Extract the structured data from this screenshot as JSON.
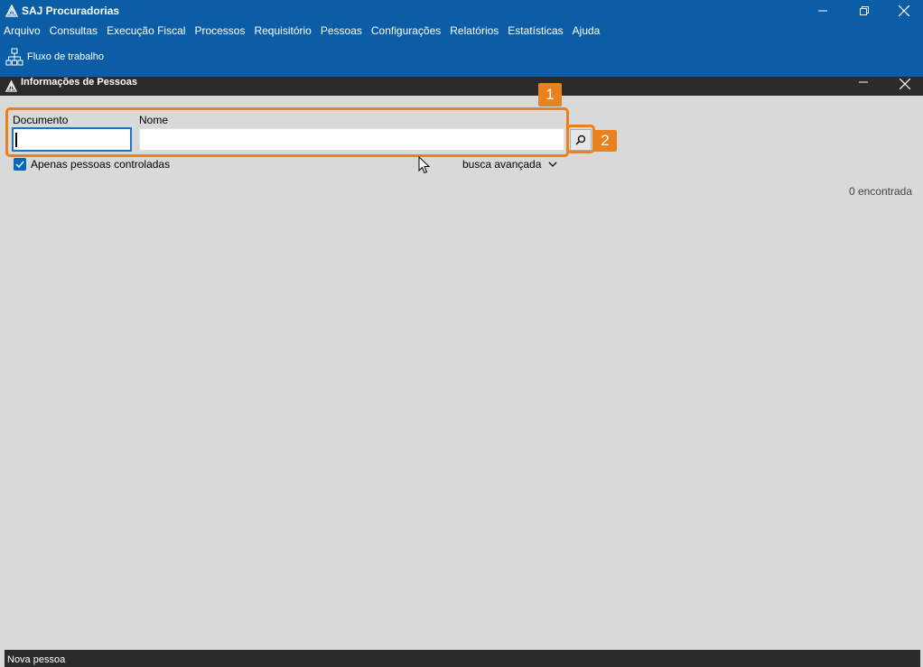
{
  "window": {
    "title": "SAJ Procuradorias",
    "minimize_icon": "minimize-icon",
    "restore_icon": "restore-icon",
    "close_icon": "close-icon"
  },
  "menubar": {
    "items": [
      "Arquivo",
      "Consultas",
      "Execução Fiscal",
      "Processos",
      "Requisitório",
      "Pessoas",
      "Configurações",
      "Relatórios",
      "Estatísticas",
      "Ajuda"
    ]
  },
  "toolbar": {
    "workflow_label": "Fluxo de trabalho",
    "workflow_icon": "workflow-icon"
  },
  "subwindow": {
    "title": "Informações de Pessoas"
  },
  "form": {
    "documento_label": "Documento",
    "documento_value": "",
    "nome_label": "Nome",
    "nome_value": "",
    "search_icon": "search-icon",
    "checkbox_label": "Apenas pessoas controladas",
    "checkbox_checked": true,
    "advanced_search_label": "busca avançada",
    "result_count": "0 encontrada"
  },
  "callouts": {
    "first": "1",
    "second": "2",
    "color": "#e8821e"
  },
  "statusbar": {
    "text": "Nova pessoa"
  },
  "colors": {
    "header_blue": "#0b5ea6",
    "dark_bar": "#2b2b2b",
    "background": "#d9d9d9",
    "checkbox_blue": "#0067c0"
  }
}
